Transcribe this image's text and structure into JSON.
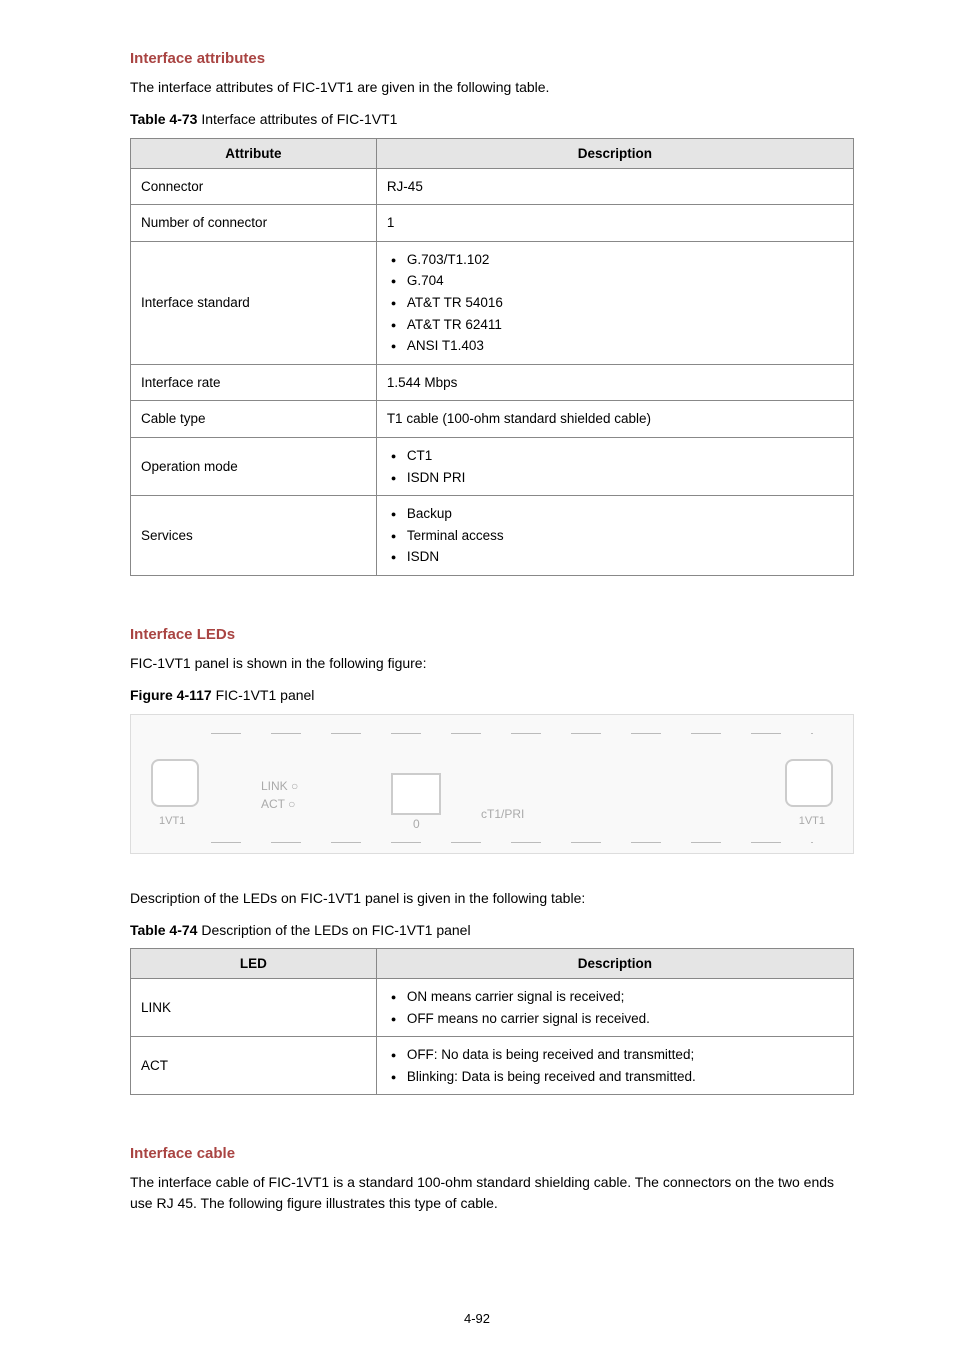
{
  "sec1": {
    "heading": "Interface attributes",
    "intro": "The interface attributes of FIC-1VT1 are given in the following table.",
    "caption_bold": "Table 4-73",
    "caption_rest": " Interface attributes of FIC-1VT1",
    "th1": "Attribute",
    "th2": "Description",
    "rows": [
      {
        "attr": "Connector",
        "desc_text": "RJ-45"
      },
      {
        "attr": "Number of connector",
        "desc_text": "1"
      },
      {
        "attr": "Interface standard",
        "desc_list": [
          "G.703/T1.102",
          "G.704",
          "AT&T TR 54016",
          "AT&T TR 62411",
          "ANSI T1.403"
        ]
      },
      {
        "attr": "Interface rate",
        "desc_text": "1.544 Mbps"
      },
      {
        "attr": "Cable type",
        "desc_text": "T1 cable (100-ohm standard shielded cable)"
      },
      {
        "attr": "Operation mode",
        "desc_list": [
          "CT1",
          "ISDN PRI"
        ]
      },
      {
        "attr": "Services",
        "desc_list": [
          "Backup",
          "Terminal access",
          "ISDN"
        ]
      }
    ]
  },
  "sec2": {
    "heading": "Interface LEDs",
    "intro": "FIC-1VT1 panel is shown in the following figure:",
    "caption_bold": "Figure 4-117",
    "caption_rest": " FIC-1VT1 panel",
    "fig": {
      "led1": "LINK  ○",
      "led2": "ACT  ○",
      "ctpri": "cT1/PRI",
      "label_l": "1VT1",
      "label_r": "1VT1"
    },
    "desc_text": "Description of the LEDs on FIC-1VT1 panel is given in the following table:",
    "caption2_bold": "Table 4-74",
    "caption2_rest": " Description of the LEDs on FIC-1VT1 panel",
    "th1": "LED",
    "th2": "Description",
    "rows": [
      {
        "led": "LINK",
        "items": [
          "ON means carrier signal is received;",
          "OFF means no carrier signal is received."
        ]
      },
      {
        "led": "ACT",
        "items": [
          "OFF: No data is being received and transmitted;",
          "Blinking: Data is being received and transmitted."
        ]
      }
    ]
  },
  "sec3": {
    "heading": "Interface cable",
    "body": "The interface cable of FIC-1VT1 is a standard 100-ohm standard shielding cable. The connectors on the two ends use RJ 45. The following figure illustrates this type of cable."
  },
  "page_num": "4-92"
}
